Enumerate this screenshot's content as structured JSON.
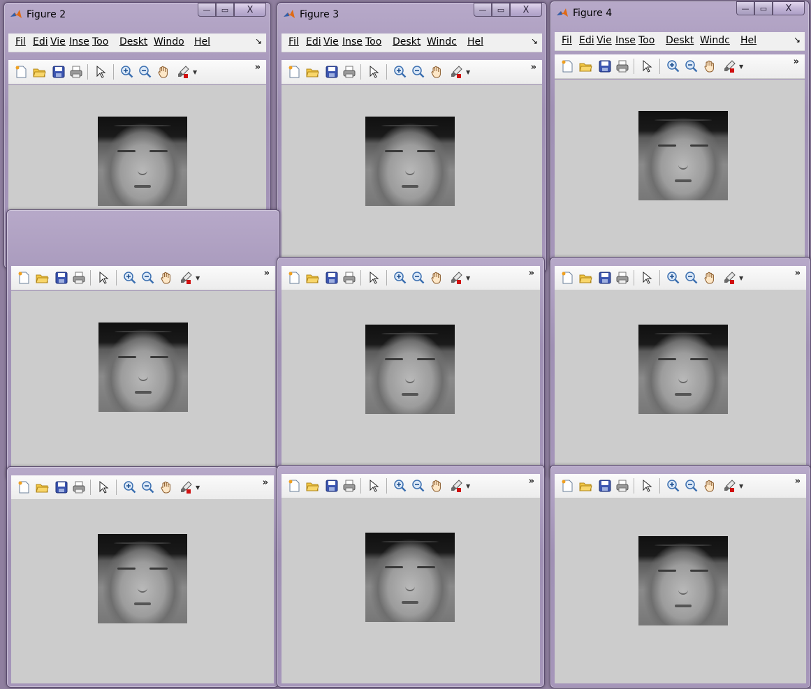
{
  "windows": [
    {
      "title": "Figure 2",
      "show_title": true,
      "show_menu": true,
      "menu": [
        "Fil",
        "Edi",
        "Vie",
        "Inse",
        "Too",
        "Deskt",
        "Windo",
        "Hel"
      ]
    },
    {
      "title": "Figure 3",
      "show_title": true,
      "show_menu": true,
      "menu": [
        "Fil",
        "Edi",
        "Vie",
        "Inse",
        "Too",
        "Deskt",
        "Windc",
        "Hel"
      ]
    },
    {
      "title": "Figure 4",
      "show_title": true,
      "show_menu": true,
      "menu": [
        "Fil",
        "Edi",
        "Vie",
        "Inse",
        "Too",
        "Deskt",
        "Windc",
        "Hel"
      ]
    },
    {
      "title": "",
      "show_title": false,
      "show_menu": false,
      "menu": []
    },
    {
      "title": "",
      "show_title": false,
      "show_menu": false,
      "menu": []
    },
    {
      "title": "",
      "show_title": false,
      "show_menu": false,
      "menu": []
    },
    {
      "title": "",
      "show_title": false,
      "show_menu": false,
      "menu": []
    },
    {
      "title": "",
      "show_title": false,
      "show_menu": false,
      "menu": []
    },
    {
      "title": "",
      "show_title": false,
      "show_menu": false,
      "menu": []
    }
  ],
  "toolbar_icons": [
    "new-figure-icon",
    "open-file-icon",
    "save-icon",
    "print-icon",
    "edit-plot-arrow-icon",
    "zoom-in-icon",
    "zoom-out-icon",
    "pan-hand-icon",
    "data-brush-icon"
  ],
  "window_controls": {
    "minimize": "—",
    "maximize": "▭",
    "close": "X"
  },
  "toolbar_overflow": "»",
  "menu_overflow": "↘",
  "colors": {
    "frame": "#a696ba",
    "canvas": "#cccccc",
    "menubar": "#f0f0f0"
  }
}
